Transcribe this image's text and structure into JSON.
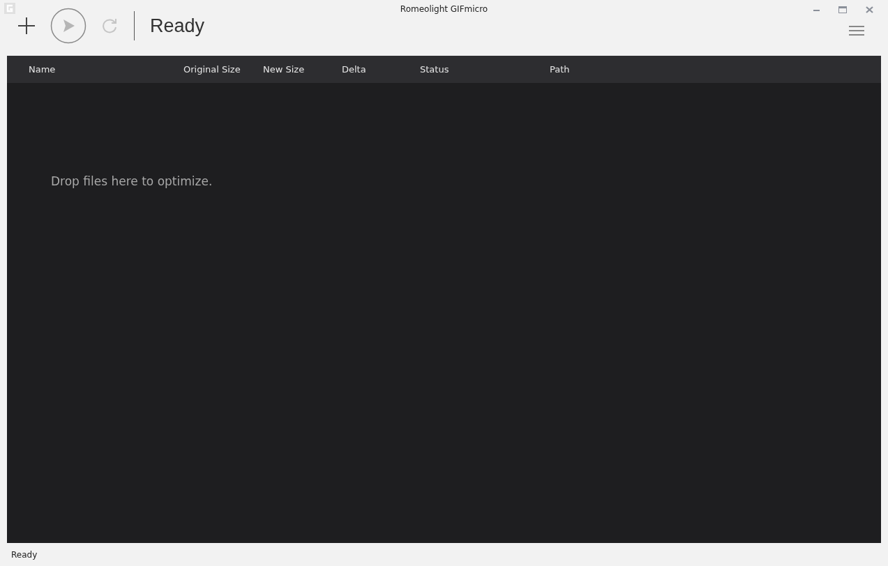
{
  "window": {
    "title": "Romeolight GIFmicro"
  },
  "toolbar": {
    "buttons": [
      {
        "kind": "add",
        "disabled": false
      },
      {
        "kind": "play",
        "disabled": true
      },
      {
        "kind": "refresh",
        "disabled": true
      }
    ],
    "status": "Ready"
  },
  "table": {
    "columns": [
      {
        "label": "Name"
      },
      {
        "label": "Original Size"
      },
      {
        "label": "New Size"
      },
      {
        "label": "Delta"
      },
      {
        "label": "Status"
      },
      {
        "label": "Path"
      }
    ],
    "empty_message": "Drop files here to optimize."
  },
  "status_bar": "Ready"
}
